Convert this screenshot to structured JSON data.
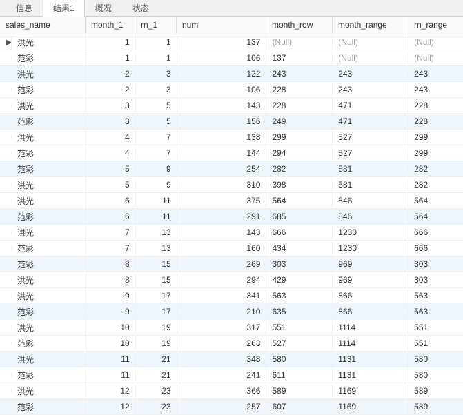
{
  "tabs": {
    "info": "信息",
    "result1": "结果1",
    "overview": "概况",
    "status": "状态"
  },
  "columns": {
    "sales_name": "sales_name",
    "month_1": "month_1",
    "rn_1": "rn_1",
    "num": "num",
    "month_row": "month_row",
    "month_range": "month_range",
    "rn_range": "rn_range"
  },
  "null_text": "(Null)",
  "rows": [
    {
      "marker": "▶",
      "sales_name": "洪光",
      "month_1": "1",
      "rn_1": "1",
      "num": "137",
      "month_row": null,
      "month_range": null,
      "rn_range": null
    },
    {
      "marker": "",
      "sales_name": "范彩",
      "month_1": "1",
      "rn_1": "1",
      "num": "106",
      "month_row": "137",
      "month_range": null,
      "rn_range": null
    },
    {
      "marker": "",
      "sales_name": "洪光",
      "month_1": "2",
      "rn_1": "3",
      "num": "122",
      "month_row": "243",
      "month_range": "243",
      "rn_range": "243"
    },
    {
      "marker": "",
      "sales_name": "范彩",
      "month_1": "2",
      "rn_1": "3",
      "num": "106",
      "month_row": "228",
      "month_range": "243",
      "rn_range": "243"
    },
    {
      "marker": "",
      "sales_name": "洪光",
      "month_1": "3",
      "rn_1": "5",
      "num": "143",
      "month_row": "228",
      "month_range": "471",
      "rn_range": "228"
    },
    {
      "marker": "",
      "sales_name": "范彩",
      "month_1": "3",
      "rn_1": "5",
      "num": "156",
      "month_row": "249",
      "month_range": "471",
      "rn_range": "228"
    },
    {
      "marker": "",
      "sales_name": "洪光",
      "month_1": "4",
      "rn_1": "7",
      "num": "138",
      "month_row": "299",
      "month_range": "527",
      "rn_range": "299"
    },
    {
      "marker": "",
      "sales_name": "范彩",
      "month_1": "4",
      "rn_1": "7",
      "num": "144",
      "month_row": "294",
      "month_range": "527",
      "rn_range": "299"
    },
    {
      "marker": "",
      "sales_name": "范彩",
      "month_1": "5",
      "rn_1": "9",
      "num": "254",
      "month_row": "282",
      "month_range": "581",
      "rn_range": "282"
    },
    {
      "marker": "",
      "sales_name": "洪光",
      "month_1": "5",
      "rn_1": "9",
      "num": "310",
      "month_row": "398",
      "month_range": "581",
      "rn_range": "282"
    },
    {
      "marker": "",
      "sales_name": "洪光",
      "month_1": "6",
      "rn_1": "11",
      "num": "375",
      "month_row": "564",
      "month_range": "846",
      "rn_range": "564"
    },
    {
      "marker": "",
      "sales_name": "范彩",
      "month_1": "6",
      "rn_1": "11",
      "num": "291",
      "month_row": "685",
      "month_range": "846",
      "rn_range": "564"
    },
    {
      "marker": "",
      "sales_name": "洪光",
      "month_1": "7",
      "rn_1": "13",
      "num": "143",
      "month_row": "666",
      "month_range": "1230",
      "rn_range": "666"
    },
    {
      "marker": "",
      "sales_name": "范彩",
      "month_1": "7",
      "rn_1": "13",
      "num": "160",
      "month_row": "434",
      "month_range": "1230",
      "rn_range": "666"
    },
    {
      "marker": "",
      "sales_name": "范彩",
      "month_1": "8",
      "rn_1": "15",
      "num": "269",
      "month_row": "303",
      "month_range": "969",
      "rn_range": "303"
    },
    {
      "marker": "",
      "sales_name": "洪光",
      "month_1": "8",
      "rn_1": "15",
      "num": "294",
      "month_row": "429",
      "month_range": "969",
      "rn_range": "303"
    },
    {
      "marker": "",
      "sales_name": "洪光",
      "month_1": "9",
      "rn_1": "17",
      "num": "341",
      "month_row": "563",
      "month_range": "866",
      "rn_range": "563"
    },
    {
      "marker": "",
      "sales_name": "范彩",
      "month_1": "9",
      "rn_1": "17",
      "num": "210",
      "month_row": "635",
      "month_range": "866",
      "rn_range": "563"
    },
    {
      "marker": "",
      "sales_name": "洪光",
      "month_1": "10",
      "rn_1": "19",
      "num": "317",
      "month_row": "551",
      "month_range": "1114",
      "rn_range": "551"
    },
    {
      "marker": "",
      "sales_name": "范彩",
      "month_1": "10",
      "rn_1": "19",
      "num": "263",
      "month_row": "527",
      "month_range": "1114",
      "rn_range": "551"
    },
    {
      "marker": "",
      "sales_name": "洪光",
      "month_1": "11",
      "rn_1": "21",
      "num": "348",
      "month_row": "580",
      "month_range": "1131",
      "rn_range": "580"
    },
    {
      "marker": "",
      "sales_name": "范彩",
      "month_1": "11",
      "rn_1": "21",
      "num": "241",
      "month_row": "611",
      "month_range": "1131",
      "rn_range": "580"
    },
    {
      "marker": "",
      "sales_name": "洪光",
      "month_1": "12",
      "rn_1": "23",
      "num": "366",
      "month_row": "589",
      "month_range": "1169",
      "rn_range": "589"
    },
    {
      "marker": "",
      "sales_name": "范彩",
      "month_1": "12",
      "rn_1": "23",
      "num": "257",
      "month_row": "607",
      "month_range": "1169",
      "rn_range": "589"
    }
  ]
}
